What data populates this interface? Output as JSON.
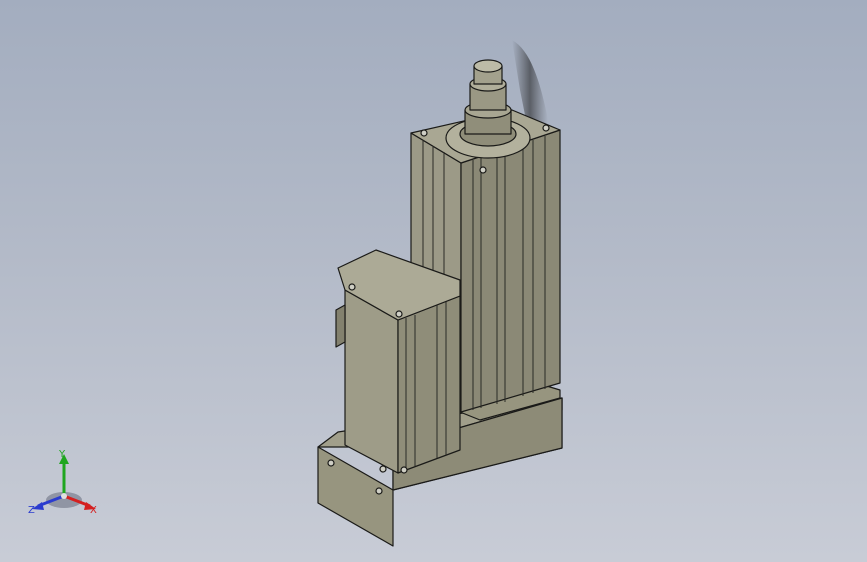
{
  "viewport": {
    "background_top": "#a3adbf",
    "background_bottom": "#c8ccd6"
  },
  "model": {
    "name": "",
    "body_color": "#8c8a78",
    "edge_color": "#1a1a18"
  },
  "triad": {
    "x_label": "X",
    "y_label": "Y",
    "z_label": "Z",
    "x_color": "#d42020",
    "y_color": "#1fa61f",
    "z_color": "#2b3ccf"
  }
}
